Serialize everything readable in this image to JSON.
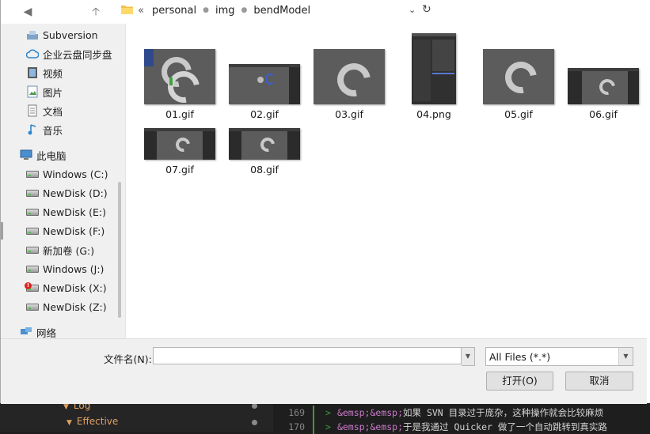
{
  "address": {
    "back_glyph": "◀",
    "up_glyph": "🡡",
    "overflow": "«",
    "crumbs": [
      "personal",
      "img",
      "bendModel"
    ],
    "dropdown_glyph": "⌄",
    "refresh_glyph": "↻"
  },
  "sidebar": {
    "items": [
      {
        "label": "Subversion",
        "icon": "subversion-icon"
      },
      {
        "label": "企业云盘同步盘",
        "icon": "cloud-icon"
      },
      {
        "label": "视频",
        "icon": "video-icon"
      },
      {
        "label": "图片",
        "icon": "pictures-icon"
      },
      {
        "label": "文档",
        "icon": "documents-icon"
      },
      {
        "label": "音乐",
        "icon": "music-icon"
      },
      {
        "label": "此电脑",
        "icon": "computer-icon"
      },
      {
        "label": "Windows (C:)",
        "icon": "drive-icon"
      },
      {
        "label": "NewDisk (D:)",
        "icon": "drive-icon"
      },
      {
        "label": "NewDisk (E:)",
        "icon": "drive-icon"
      },
      {
        "label": "NewDisk (F:)",
        "icon": "drive-icon"
      },
      {
        "label": "新加卷 (G:)",
        "icon": "drive-icon"
      },
      {
        "label": "Windows (J:)",
        "icon": "drive-icon"
      },
      {
        "label": "NewDisk (X:)",
        "icon": "drive-error-icon"
      },
      {
        "label": "NewDisk (Z:)",
        "icon": "drive-icon"
      },
      {
        "label": "网络",
        "icon": "network-icon"
      }
    ]
  },
  "files": [
    {
      "name": "01.gif"
    },
    {
      "name": "02.gif"
    },
    {
      "name": "03.gif"
    },
    {
      "name": "04.png"
    },
    {
      "name": "05.gif"
    },
    {
      "name": "06.gif"
    },
    {
      "name": "07.gif"
    },
    {
      "name": "08.gif"
    }
  ],
  "footer": {
    "filename_label": "文件名(N):",
    "filename_value": "",
    "filetype_selected": "All Files (*.*)",
    "open_label": "打开(O)",
    "cancel_label": "取消"
  },
  "background": {
    "tree": [
      {
        "label": "Log"
      },
      {
        "label": "Effective"
      }
    ],
    "lines": [
      {
        "num": "169",
        "gt": ">",
        "entity": "&emsp;&emsp;",
        "text": "如果 SVN 目录过于庞杂，这种操作就会比较麻烦"
      },
      {
        "num": "170",
        "gt": ">",
        "entity": "&emsp;&emsp;",
        "text": "于是我通过 Quicker 做了一个自动跳转到真实路"
      }
    ]
  },
  "colors": {
    "accent_folder": "#f2c04a",
    "editor_bg": "#1e1e1e",
    "git_bar": "#3d9a3d"
  }
}
